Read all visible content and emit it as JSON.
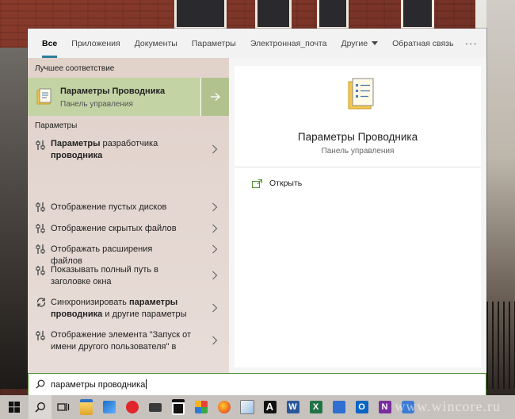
{
  "tabs": [
    {
      "label": "Все",
      "active": true
    },
    {
      "label": "Приложения"
    },
    {
      "label": "Документы"
    },
    {
      "label": "Параметры"
    },
    {
      "label": "Электронная_почта"
    },
    {
      "label": "Другие"
    }
  ],
  "feedback_label": "Обратная связь",
  "more_label": "···",
  "best_match": {
    "section_label": "Лучшее соответствие",
    "title": "Параметры Проводника",
    "subtitle": "Панель управления"
  },
  "settings": {
    "section_label": "Параметры",
    "items": [
      {
        "bold1": "Параметры",
        "text1": " разработчика",
        "bold2": "проводника",
        "text2": ""
      },
      {
        "text": "Отображение пустых дисков"
      },
      {
        "text": "Отображение скрытых файлов"
      },
      {
        "text": "Отображать расширения файлов"
      },
      {
        "text": "Показывать полный путь в заголовке окна"
      },
      {
        "pre": "Синхронизировать ",
        "bold": "параметры проводника",
        "post": " и другие параметры"
      },
      {
        "text": "Отображение элемента \"Запуск от имени другого пользователя\" в"
      }
    ]
  },
  "detail": {
    "title": "Параметры Проводника",
    "subtitle": "Панель управления",
    "open_label": "Открыть"
  },
  "search": {
    "value": "параметры проводника"
  },
  "watermark": "www.wincore.ru",
  "colors": {
    "accent_tab": "#2d7d9a",
    "best_match_bg": "#c4d3a4",
    "search_border": "#4d8f2f"
  },
  "taskbar_icons": [
    "windows-start-icon",
    "search-icon",
    "task-view-icon",
    "file-explorer-icon",
    "photos-icon",
    "vivaldi-icon",
    "mail-icon",
    "store-icon",
    "apps-grid-icon",
    "firefox-icon",
    "paint-icon",
    "a-app-icon",
    "word-icon",
    "excel-icon",
    "onenote-icon",
    "outlook-icon",
    "onenote-purple-icon",
    "app-icon"
  ]
}
